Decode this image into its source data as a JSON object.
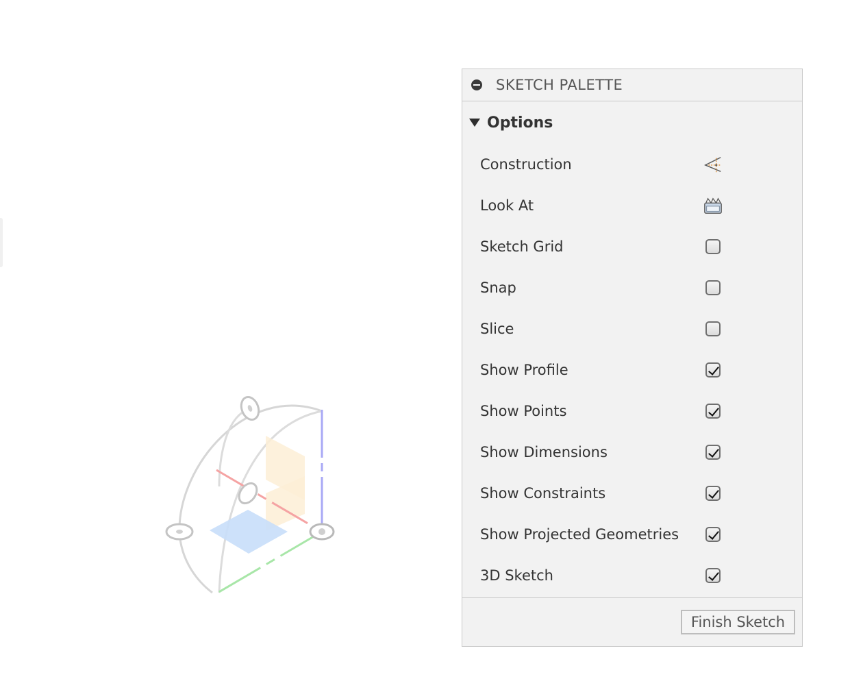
{
  "palette": {
    "title": "SKETCH PALETTE",
    "minimize_icon": "minimize-icon",
    "section": {
      "title": "Options",
      "icon": "caret-down-icon"
    },
    "options": [
      {
        "label": "Construction",
        "control": "construction-icon"
      },
      {
        "label": "Look At",
        "control": "look-at-icon"
      },
      {
        "label": "Sketch Grid",
        "control": "checkbox",
        "checked": false
      },
      {
        "label": "Snap",
        "control": "checkbox",
        "checked": false
      },
      {
        "label": "Slice",
        "control": "checkbox",
        "checked": false
      },
      {
        "label": "Show Profile",
        "control": "checkbox",
        "checked": true
      },
      {
        "label": "Show Points",
        "control": "checkbox",
        "checked": true
      },
      {
        "label": "Show Dimensions",
        "control": "checkbox",
        "checked": true
      },
      {
        "label": "Show Constraints",
        "control": "checkbox",
        "checked": true
      },
      {
        "label": "Show Projected Geometries",
        "control": "checkbox",
        "checked": true
      },
      {
        "label": "3D Sketch",
        "control": "checkbox",
        "checked": true
      }
    ],
    "finish_label": "Finish Sketch"
  },
  "viewport": {
    "gizmo_icon": "sketch-orientation-gizmo-icon",
    "axis_colors": {
      "x": "#f08a8a",
      "y": "#8cd98c",
      "z": "#8f8ff0"
    }
  }
}
